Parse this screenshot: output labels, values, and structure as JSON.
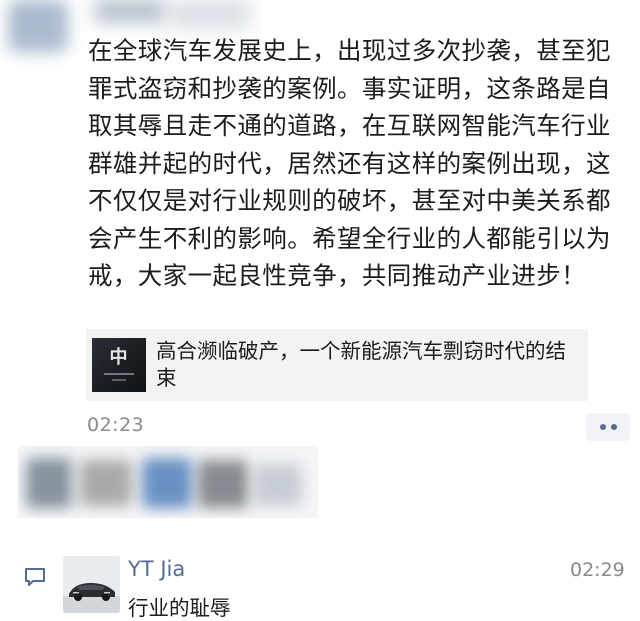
{
  "post": {
    "text": "在全球汽车发展史上，出现过多次抄袭，甚至犯罪式盗窃和抄袭的案例。事实证明，这条路是自取其辱且走不通的道路，在互联网智能汽车行业群雄并起的时代，居然还有这样的案例出现，这不仅仅是对行业规则的破坏，甚至对中美关系都会产生不利的影响。希望全行业的人都能引以为戒，大家一起良性竞争，共同推动产业进步！",
    "time": "02:23"
  },
  "shared_link": {
    "thumb_mark": "中",
    "title": "高合濒临破产，一个新能源汽车剽窃时代的结束"
  },
  "comment": {
    "author": "YT Jia",
    "time": "02:29",
    "text": "行业的耻辱"
  },
  "colors": {
    "link_blue": "#566b93",
    "secondary_gray": "#8a8a8a",
    "card_bg": "#f3f3f3"
  },
  "icons": {
    "more": "more-dots-icon",
    "comment": "comment-bubble-icon"
  }
}
